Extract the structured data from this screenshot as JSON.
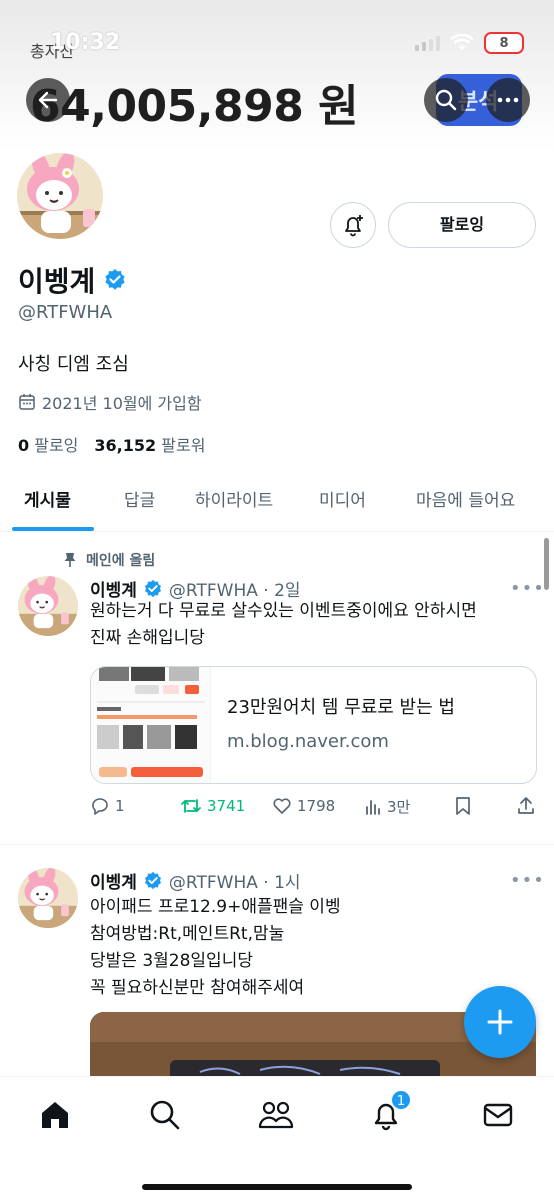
{
  "status_bar": {
    "time": "10:32",
    "battery": "8"
  },
  "header": {
    "asset_label": "총자산",
    "asset_amount": "64,005,898 원",
    "analysis_label": "분석"
  },
  "profile": {
    "display_name": "이벵계",
    "handle": "@RTFWHA",
    "bio": "사칭 디엠 조심",
    "joined": "2021년 10월에 가입함",
    "following_count": "0",
    "following_label": "팔로잉",
    "followers_count": "36,152",
    "followers_label": "팔로워",
    "follow_button": "팔로잉"
  },
  "tabs": [
    {
      "label": "게시물",
      "active": true
    },
    {
      "label": "답글"
    },
    {
      "label": "하이라이트"
    },
    {
      "label": "미디어"
    },
    {
      "label": "마음에 들어요"
    }
  ],
  "posts": [
    {
      "pinned_label": "메인에 올림",
      "name": "이벵계",
      "handle_time": "@RTFWHA · 2일",
      "text_lines": [
        "원하는거 다 무료로 살수있는 이벤트중이에요 안하시면",
        "진짜 손해입니당"
      ],
      "card": {
        "title": "23만원어치 템 무료로 받는 법",
        "domain": "m.blog.naver.com"
      },
      "replies": "1",
      "reposts": "3741",
      "likes": "1798",
      "views": "3만"
    },
    {
      "name": "이벵계",
      "handle_time": "@RTFWHA · 1시",
      "text_lines": [
        "아이패드 프로12.9+애플팬슬 이벵",
        "참여방법:Rt,메인트Rt,맘눌",
        "당발은 3월28일입니당",
        "꼭 필요하신분만 참여해주세여"
      ]
    }
  ],
  "bottom_nav": {
    "notification_badge": "1"
  },
  "colors": {
    "accent": "#1d9bf0",
    "repost_green": "#00ba7c",
    "verified": "#1d9bf0",
    "analysis_blue": "#3560d8"
  }
}
